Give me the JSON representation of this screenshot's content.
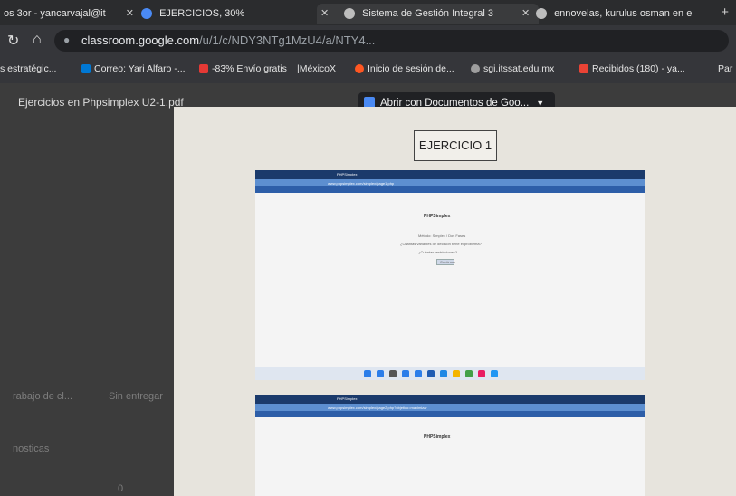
{
  "tabs": [
    {
      "label": "os 3or - yancarvajal@it",
      "icon_color": "#8ab4f8"
    },
    {
      "label": "EJERCICIOS, 30%",
      "icon_color": "#4a8af4"
    },
    {
      "label": "Sistema de Gestión Integral 3",
      "icon_color": "#bdbdbd"
    },
    {
      "label": "ennovelas, kurulus osman en e",
      "icon_color": "#bdbdbd"
    }
  ],
  "url": {
    "host": "classroom.google.com",
    "path": "/u/1/c/NDY3NTg1MzU4/a/NTY4..."
  },
  "bookmarks": [
    {
      "label": "s estratégic...",
      "color": "#777777"
    },
    {
      "label": "Correo: Yari Alfaro -...",
      "color": "#0078d4"
    },
    {
      "label": "-83% Envío gratis",
      "color": "#e53935"
    },
    {
      "label": "|MéxicoX",
      "color": "#555555"
    },
    {
      "label": "Inicio de sesión de...",
      "color": "#ff5722"
    },
    {
      "label": "sgi.itssat.edu.mx",
      "color": "#9e9e9e"
    },
    {
      "label": "Recibidos (180) - ya...",
      "color": "#ea4335"
    },
    {
      "label": "Par",
      "color": "#555555"
    }
  ],
  "viewer": {
    "file_name": "Ejercicios en Phpsimplex U2-1.pdf",
    "open_with": "Abrir con Documentos de Goo..."
  },
  "page": {
    "exercise_label": "EJERCICIO 1"
  },
  "shot1": {
    "tab": "PHPSimplex",
    "url": "www.phpsimplex.com/simplex/page1.php",
    "heading": "PHPSimplex",
    "line1": "Método: Simplex / Dos Fases",
    "line2": "¿Cuántas variables de decisión tiene el problema?",
    "line3": "¿Cuántas restricciones?",
    "button": "Continuar"
  },
  "shot2": {
    "tab": "PHPSimplex",
    "url": "www.phpsimplex.com/simplex/page2.php?objetivo=maximizar",
    "heading": "PHPSimplex"
  },
  "side_texts": [
    "rabajo de cl...",
    "Sin entregar",
    "nosticas",
    "0"
  ]
}
